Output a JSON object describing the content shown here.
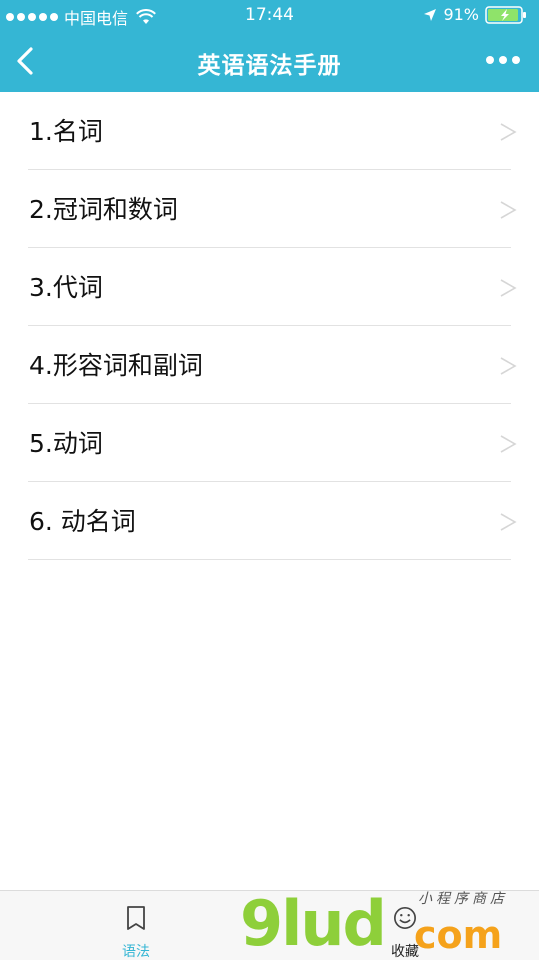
{
  "status_bar": {
    "carrier": "中国电信",
    "time": "17:44",
    "battery_percent": "91%"
  },
  "nav": {
    "title": "英语语法手册"
  },
  "list": {
    "items": [
      {
        "label": "1.名词"
      },
      {
        "label": "2.冠词和数词"
      },
      {
        "label": "3.代词"
      },
      {
        "label": "4.形容词和副词"
      },
      {
        "label": "5.动词"
      },
      {
        "label": "6. 动名词"
      }
    ],
    "chevron": ">"
  },
  "tabbar": {
    "tabs": [
      {
        "label": "语法",
        "icon": "bookmark-icon",
        "active": true
      },
      {
        "label": "收藏",
        "icon": "smile-icon",
        "active": false
      }
    ]
  },
  "watermark": {
    "main": "9lud",
    "com": "com",
    "cn": "小程序商店"
  },
  "colors": {
    "header": "#35b6d4",
    "active_tab": "#35b6d4"
  }
}
